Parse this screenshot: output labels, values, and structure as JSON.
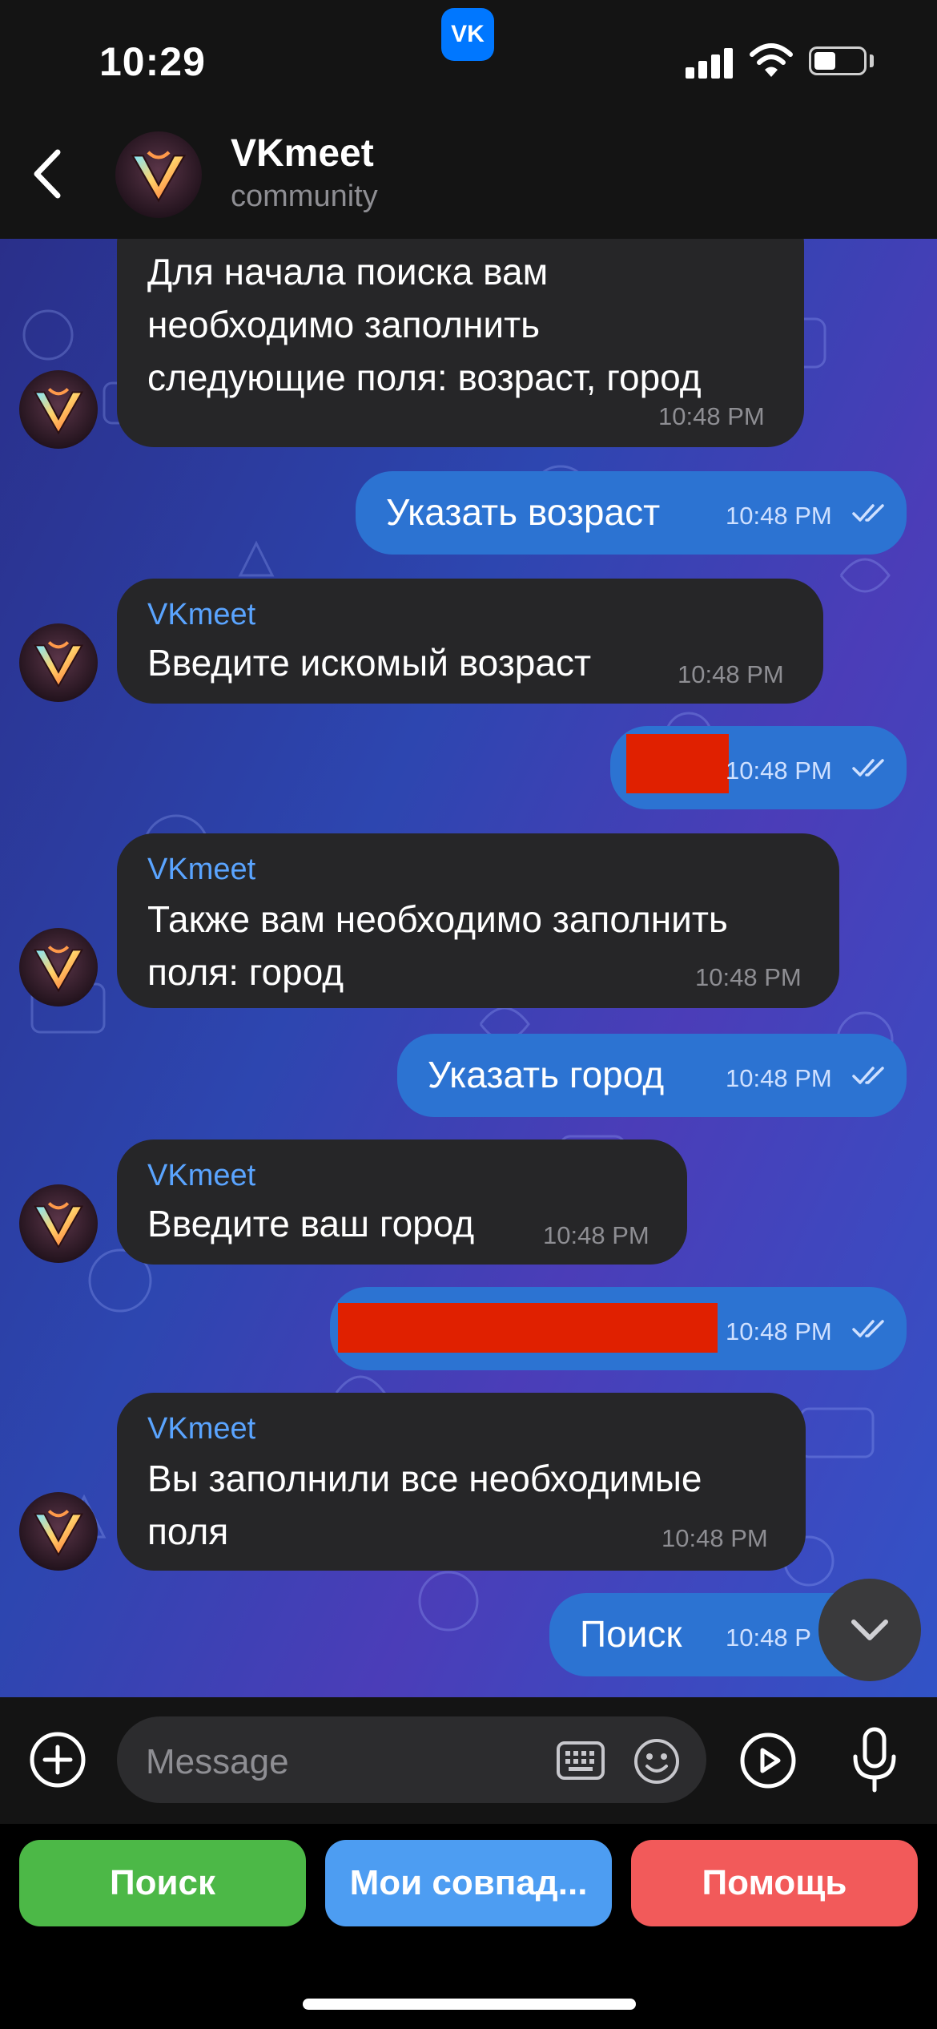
{
  "status_bar": {
    "time": "10:29",
    "app_badge": "VK"
  },
  "header": {
    "title": "VKmeet",
    "subtitle": "community"
  },
  "messages": [
    {
      "text": "Для начала поиска вам\nнеобходимо заполнить\nследующие поля: возраст, город",
      "time": "10:48 PM"
    },
    {
      "text": "Указать возраст",
      "time": "10:48 PM"
    },
    {
      "sender": "VKmeet",
      "text": "Введите искомый возраст",
      "time": "10:48 PM"
    },
    {
      "text": "",
      "time": "10:48 PM"
    },
    {
      "sender": "VKmeet",
      "text": "Также вам необходимо заполнить\nполя: город",
      "time": "10:48 PM"
    },
    {
      "text": "Указать город",
      "time": "10:48 PM"
    },
    {
      "sender": "VKmeet",
      "text": "Введите ваш город",
      "time": "10:48 PM"
    },
    {
      "text": "",
      "time": "10:48 PM"
    },
    {
      "sender": "VKmeet",
      "text": "Вы заполнили все необходимые\nполя",
      "time": "10:48 PM"
    },
    {
      "text": "Поиск",
      "time": "10:48 P"
    }
  ],
  "composer": {
    "placeholder": "Message"
  },
  "keyboard_buttons": [
    {
      "label": "Поиск",
      "color": "#4cb847"
    },
    {
      "label": "Мои совпад...",
      "color": "#4d9df2"
    },
    {
      "label": "Помощь",
      "color": "#f25a5a"
    }
  ],
  "colors": {
    "incoming_bubble": "#262628",
    "outgoing_bubble": "#2c73d2",
    "accent": "#5aa4ff"
  }
}
